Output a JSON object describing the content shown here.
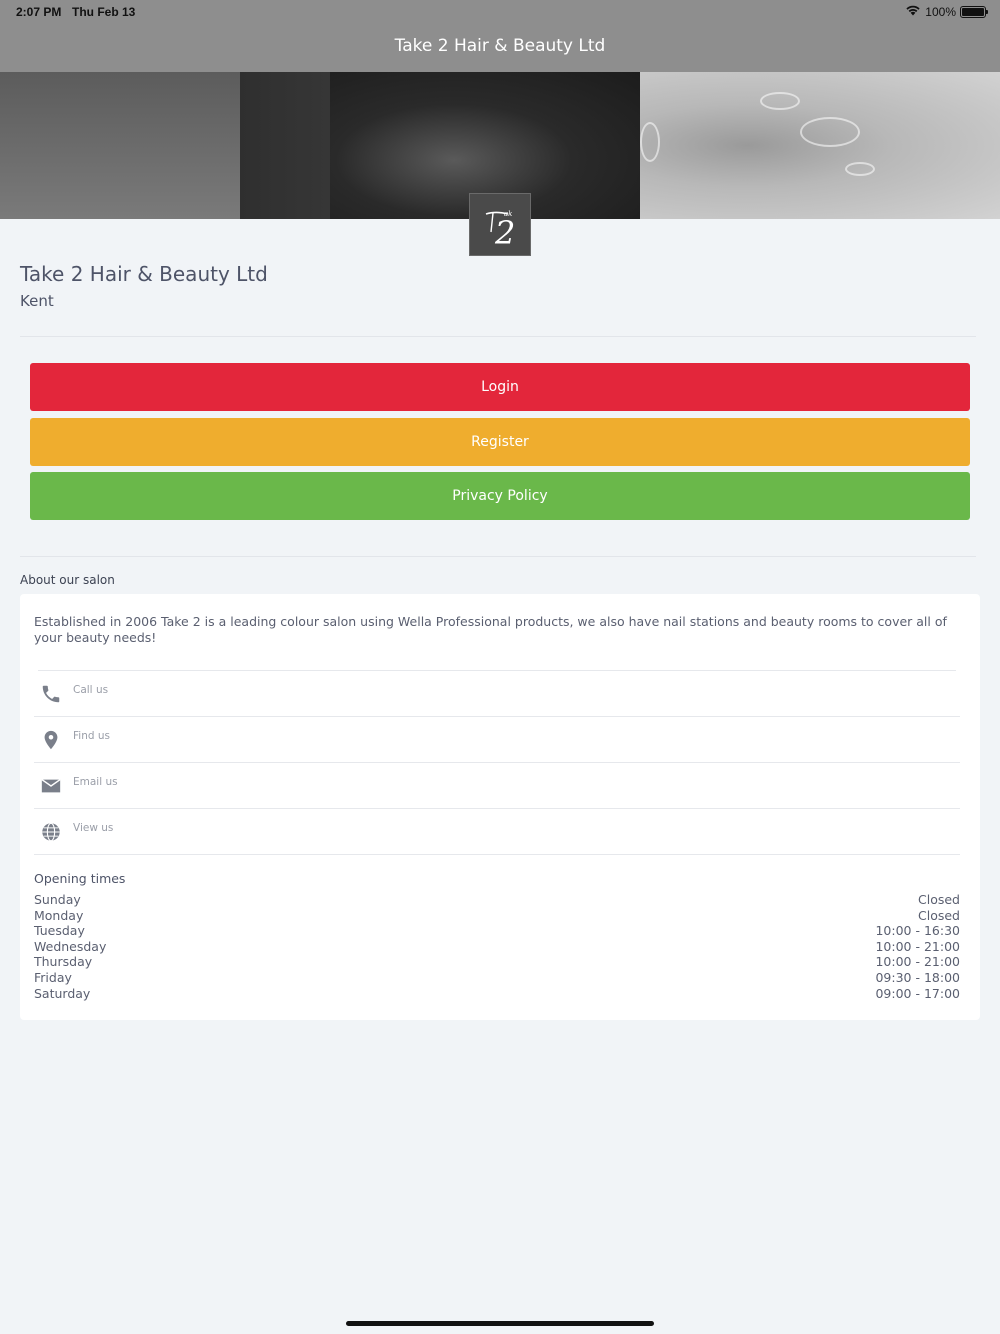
{
  "status_bar": {
    "time": "2:07 PM",
    "date": "Thu Feb 13",
    "battery": "100%"
  },
  "nav": {
    "title": "Take 2 Hair & Beauty Ltd"
  },
  "logo": {
    "text": "2"
  },
  "salon": {
    "name": "Take 2 Hair & Beauty Ltd",
    "location": "Kent"
  },
  "buttons": {
    "login": "Login",
    "register": "Register",
    "privacy": "Privacy Policy"
  },
  "colors": {
    "login": "#e3263b",
    "register": "#efad2e",
    "privacy": "#6ab84a"
  },
  "about": {
    "title": "About our salon",
    "text": "Established in 2006 Take 2 is a leading colour salon using Wella Professional products, we also have nail stations and beauty rooms to cover all of your beauty needs!"
  },
  "contacts": [
    {
      "label": "Call us",
      "icon": "phone-icon"
    },
    {
      "label": "Find us",
      "icon": "location-pin-icon"
    },
    {
      "label": "Email us",
      "icon": "envelope-icon"
    },
    {
      "label": "View us",
      "icon": "globe-icon"
    }
  ],
  "opening_times": {
    "title": "Opening times",
    "days": [
      {
        "day": "Sunday",
        "hours": "Closed"
      },
      {
        "day": "Monday",
        "hours": "Closed"
      },
      {
        "day": "Tuesday",
        "hours": "10:00 - 16:30"
      },
      {
        "day": "Wednesday",
        "hours": "10:00 - 21:00"
      },
      {
        "day": "Thursday",
        "hours": "10:00 - 21:00"
      },
      {
        "day": "Friday",
        "hours": "09:30 - 18:00"
      },
      {
        "day": "Saturday",
        "hours": "09:00 - 17:00"
      }
    ]
  }
}
